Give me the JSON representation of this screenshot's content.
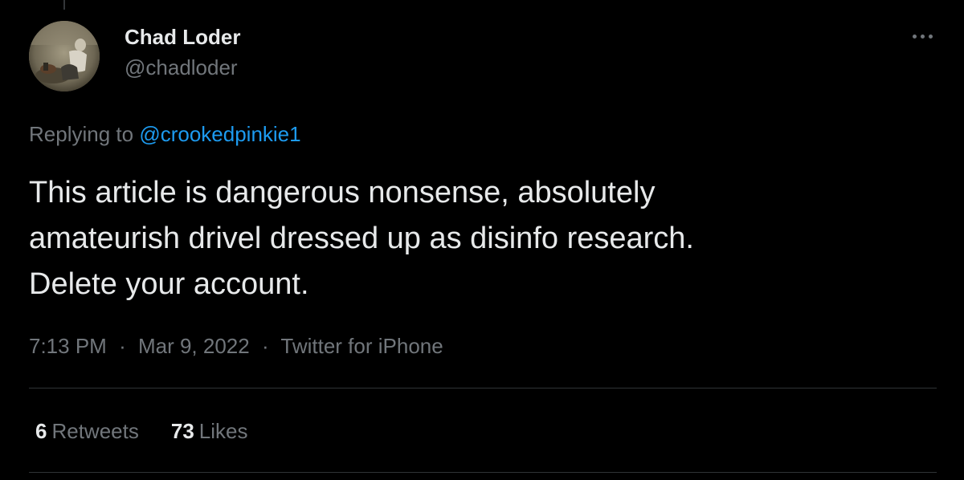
{
  "author": {
    "display_name": "Chad Loder",
    "handle": "@chadloder"
  },
  "reply": {
    "prefix": "Replying to",
    "mention": "@crookedpinkie1"
  },
  "tweet": {
    "lines": [
      "This article is dangerous nonsense, absolutely",
      "amateurish drivel dressed up as disinfo research.",
      "Delete your account."
    ]
  },
  "meta": {
    "time": "7:13 PM",
    "separator": "·",
    "date": "Mar 9, 2022",
    "source": "Twitter for iPhone"
  },
  "stats": {
    "retweets_count": "6",
    "retweets_label": "Retweets",
    "likes_count": "73",
    "likes_label": "Likes"
  },
  "icons": {
    "more": "more-horizontal-icon"
  },
  "colors": {
    "background": "#000000",
    "text": "#e7e9ea",
    "secondary": "#71767b",
    "link": "#1d9bf0",
    "divider": "#2f3336"
  }
}
